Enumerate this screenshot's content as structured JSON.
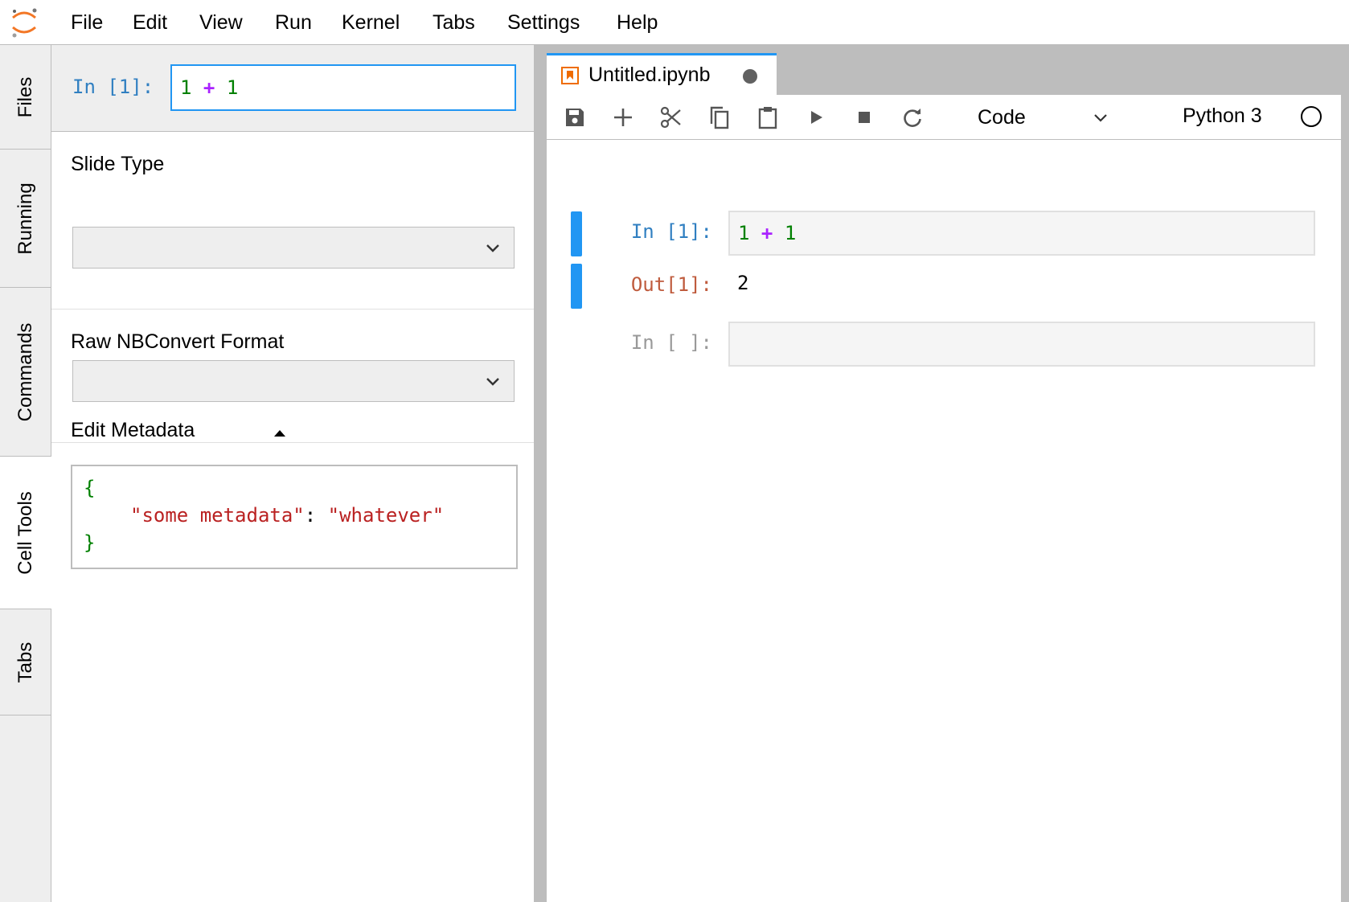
{
  "menubar": {
    "logo_icon": "jupyter-logo-icon",
    "items": [
      "File",
      "Edit",
      "View",
      "Run",
      "Kernel",
      "Tabs",
      "Settings",
      "Help"
    ]
  },
  "left_tabs": [
    {
      "label": "Files",
      "active": false
    },
    {
      "label": "Running",
      "active": false
    },
    {
      "label": "Commands",
      "active": false
    },
    {
      "label": "Cell Tools",
      "active": true
    },
    {
      "label": "Tabs",
      "active": false
    }
  ],
  "cell_tools": {
    "preview": {
      "prompt": "In [1]:",
      "code": {
        "a": "1",
        "op": "+",
        "b": "1"
      }
    },
    "slide_type": {
      "label": "Slide Type",
      "value": ""
    },
    "raw_format": {
      "label": "Raw NBConvert Format",
      "value": ""
    },
    "metadata": {
      "label": "Edit Metadata",
      "open_brace": "{",
      "key": "\"some metadata\"",
      "colon": ":",
      "value": "\"whatever\"",
      "close_brace": "}"
    }
  },
  "notebook": {
    "tab": {
      "title": "Untitled.ipynb",
      "icon": "notebook-icon",
      "dirty": true
    },
    "toolbar": {
      "buttons": [
        "save-icon",
        "add-icon",
        "cut-icon",
        "copy-icon",
        "paste-icon",
        "run-icon",
        "stop-icon",
        "restart-icon"
      ],
      "cell_type": "Code",
      "kernel_name": "Python 3",
      "kernel_idle": true
    },
    "cells": [
      {
        "prompt": "In [1]:",
        "code": {
          "a": "1",
          "op": "+",
          "b": "1"
        },
        "out_prompt": "Out[1]:",
        "output": "2"
      },
      {
        "prompt": "In [ ]:",
        "code": ""
      }
    ]
  },
  "colors": {
    "accent": "#2196f3",
    "in_prompt": "#307fc1",
    "out_prompt": "#bf5b3d",
    "number": "#008000",
    "operator": "#aa22ff",
    "string": "#ba2121"
  }
}
